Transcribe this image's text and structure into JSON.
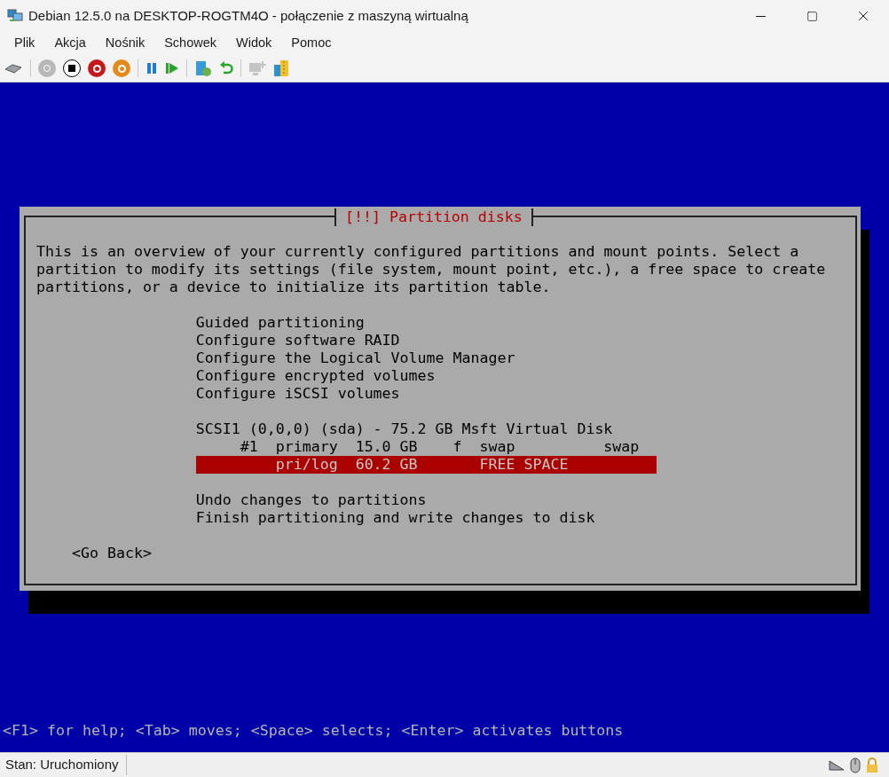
{
  "window": {
    "title": "Debian 12.5.0 na DESKTOP-ROGTM4O - połączenie z maszyną wirtualną"
  },
  "menu": [
    "Plik",
    "Akcja",
    "Nośnik",
    "Schowek",
    "Widok",
    "Pomoc"
  ],
  "dialog": {
    "title": "[!!] Partition disks",
    "description": "This is an overview of your currently configured partitions and mount points. Select a partition to modify its settings (file system, mount point, etc.), a free space to create partitions, or a device to initialize its partition table.",
    "actions": [
      {
        "text": "Guided partitioning",
        "selected": false
      },
      {
        "text": "Configure software RAID",
        "selected": false
      },
      {
        "text": "Configure the Logical Volume Manager",
        "selected": false
      },
      {
        "text": "Configure encrypted volumes",
        "selected": false
      },
      {
        "text": "Configure iSCSI volumes",
        "selected": false
      }
    ],
    "disk": {
      "label": "SCSI1 (0,0,0) (sda) - 75.2 GB Msft Virtual Disk",
      "partitions": [
        {
          "text": "     #1  primary  15.0 GB    f  swap          swap",
          "selected": false
        },
        {
          "text": "         pri/log  60.2 GB       FREE SPACE",
          "selected": true
        }
      ]
    },
    "final_actions": [
      {
        "text": "Undo changes to partitions",
        "selected": false
      },
      {
        "text": "Finish partitioning and write changes to disk",
        "selected": false
      }
    ],
    "back_button": "<Go Back>"
  },
  "help_line": "<F1> for help; <Tab> moves; <Space> selects; <Enter> activates buttons",
  "status_bar": {
    "text": "Stan: Uruchomiony"
  }
}
